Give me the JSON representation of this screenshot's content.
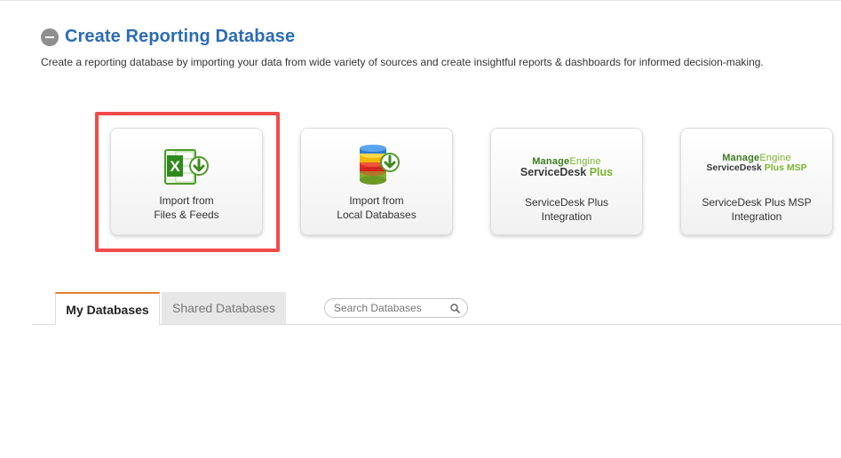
{
  "header": {
    "title": "Create Reporting Database",
    "subtitle": "Create a reporting database by importing your data from wide variety of sources and create insightful reports & dashboards for informed decision-making."
  },
  "cards": [
    {
      "line1": "Import from",
      "line2": "Files & Feeds",
      "icon": "excel-import-icon"
    },
    {
      "line1": "Import from",
      "line2": "Local Databases",
      "icon": "database-import-icon"
    },
    {
      "line1": "ServiceDesk Plus",
      "line2": "Integration",
      "logo_brand": "Manage",
      "logo_brand_2": "Engine",
      "logo_product": "ServiceDesk",
      "logo_plus": " Plus"
    },
    {
      "line1": "ServiceDesk Plus MSP",
      "line2": "Integration",
      "logo_brand": "Manage",
      "logo_brand_2": "Engine",
      "logo_product": "ServiceDesk",
      "logo_plus": " Plus MSP"
    }
  ],
  "tabs": [
    {
      "label": "My Databases",
      "active": true
    },
    {
      "label": "Shared Databases",
      "active": false
    }
  ],
  "search": {
    "placeholder": "Search Databases",
    "icon": "search-icon"
  },
  "colors": {
    "title": "#2c6cb5",
    "highlight": "#f04b4b",
    "tab_accent": "#e57c30",
    "brand_green": "#7ab32e"
  }
}
